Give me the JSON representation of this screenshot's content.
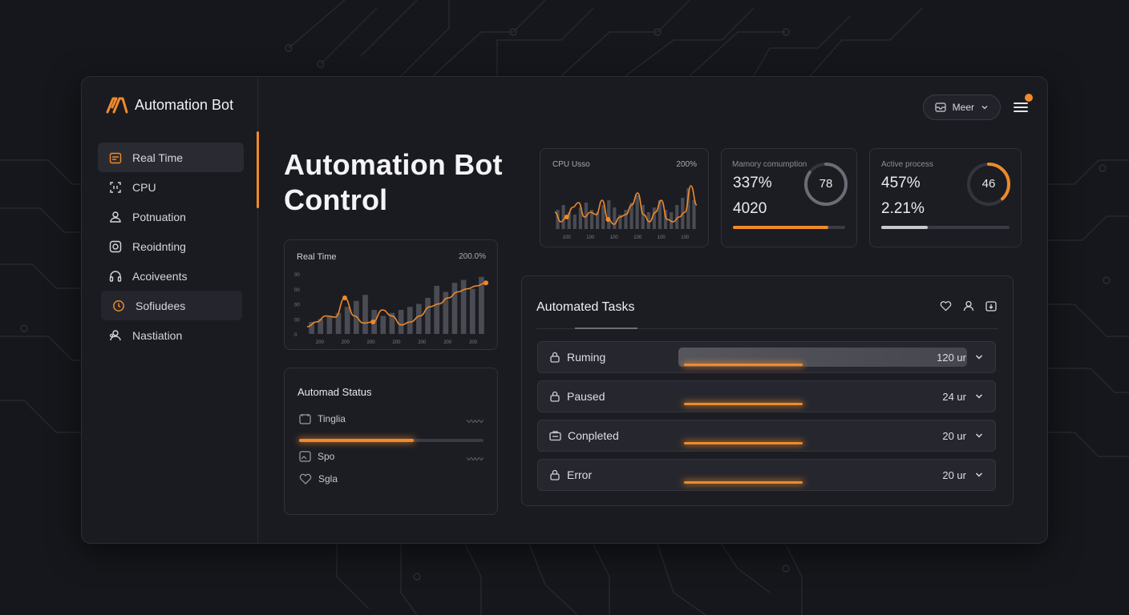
{
  "app": {
    "name": "Automation Bot"
  },
  "header": {
    "title_line1": "Automation Bot",
    "title_line2": "Control",
    "user_label": "Meer"
  },
  "sidebar": {
    "items": [
      {
        "label": "Real Time",
        "icon": "calendar-icon"
      },
      {
        "label": "CPU",
        "icon": "cpu-icon"
      },
      {
        "label": "Potnuation",
        "icon": "user-icon"
      },
      {
        "label": "Reoidnting",
        "icon": "camera-icon"
      },
      {
        "label": "Acoiveents",
        "icon": "headset-icon"
      },
      {
        "label": "Sofiudees",
        "icon": "clock-icon"
      },
      {
        "label": "Nastiation",
        "icon": "users-icon"
      }
    ]
  },
  "cpu_card": {
    "label": "CPU Usso",
    "value": "200%"
  },
  "memory_card": {
    "label": "Mamory comumption",
    "value1": "337%",
    "value2": "4020",
    "ring_value": "78",
    "ring_fraction": 0.85,
    "bar_fraction": 0.85
  },
  "process_card": {
    "label": "Active process",
    "value1": "457%",
    "value2": "2.21%",
    "ring_value": "46",
    "ring_fraction": 0.38,
    "bar_fraction": 0.36
  },
  "realtime_card": {
    "label": "Real Time",
    "value": "200.0%"
  },
  "status_card": {
    "title": "Automad Status",
    "rows": [
      {
        "label": "Tinglia",
        "icon": "calendar-icon",
        "wave": "〰〰"
      },
      {
        "label": "Spo",
        "icon": "image-icon",
        "wave": "〰〰"
      },
      {
        "label": "Sgla",
        "icon": "heart-icon"
      }
    ],
    "progress_fraction": 0.62
  },
  "tasks": {
    "title": "Automated Tasks",
    "rows": [
      {
        "label": "Ruming",
        "value": "120 ur",
        "icon": "lock-icon"
      },
      {
        "label": "Paused",
        "value": "24 ur",
        "icon": "lock-icon"
      },
      {
        "label": "Conpleted",
        "value": "20 ur",
        "icon": "briefcase-icon"
      },
      {
        "label": "Error",
        "value": "20 ur",
        "icon": "lock-icon"
      }
    ]
  },
  "colors": {
    "accent": "#f08a2a",
    "bg": "#16171c",
    "card": "#1c1d23"
  },
  "chart_data": [
    {
      "type": "line",
      "title": "CPU Usso",
      "categories": [
        "100",
        "100",
        "100",
        "100",
        "100",
        "100"
      ],
      "series": [
        {
          "values": [
            0.35,
            0.15,
            0.25,
            0.45,
            0.55,
            0.25,
            0.35,
            0.3,
            0.6,
            0.2,
            0.1,
            0.25,
            0.3,
            0.5,
            0.75,
            0.3,
            0.15,
            0.35,
            0.6,
            0.2,
            0.15,
            0.25,
            0.35,
            0.9,
            0.5
          ]
        }
      ],
      "bars": [
        0.4,
        0.5,
        0.35,
        0.3,
        0.45,
        0.55,
        0.4,
        0.35,
        0.5,
        0.6,
        0.45,
        0.3,
        0.4,
        0.55,
        0.7,
        0.5,
        0.35,
        0.45,
        0.6,
        0.4,
        0.35,
        0.5,
        0.65,
        0.85,
        0.6
      ]
    },
    {
      "type": "line",
      "title": "Real Time",
      "categories": [
        "200",
        "200",
        "200",
        "200",
        "200",
        "200",
        "200"
      ],
      "yticks": [
        "00",
        "00",
        "00",
        "00",
        "0"
      ],
      "series": [
        {
          "values": [
            0.12,
            0.2,
            0.3,
            0.28,
            0.6,
            0.3,
            0.18,
            0.2,
            0.4,
            0.3,
            0.15,
            0.2,
            0.3,
            0.45,
            0.5,
            0.6,
            0.7,
            0.75,
            0.8,
            0.85
          ]
        }
      ],
      "bars": [
        0.2,
        0.25,
        0.3,
        0.35,
        0.45,
        0.55,
        0.65,
        0.4,
        0.3,
        0.35,
        0.4,
        0.45,
        0.5,
        0.6,
        0.8,
        0.7,
        0.85,
        0.9,
        0.75,
        0.95
      ]
    }
  ]
}
